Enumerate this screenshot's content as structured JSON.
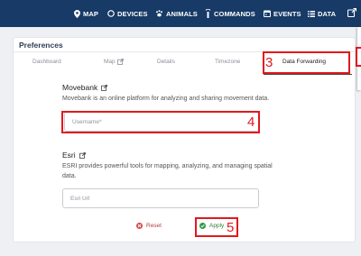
{
  "nav": {
    "items": [
      {
        "label": "MAP",
        "icon": "map-marker-icon"
      },
      {
        "label": "DEVICES",
        "icon": "devices-icon"
      },
      {
        "label": "ANIMALS",
        "icon": "paw-icon"
      },
      {
        "label": "COMMANDS",
        "icon": "antenna-icon"
      },
      {
        "label": "EVENTS",
        "icon": "calendar-icon"
      },
      {
        "label": "DATA",
        "icon": "list-icon"
      }
    ],
    "edge_icon": "export-icon",
    "bar_color": "#173a66"
  },
  "preferences": {
    "title": "Preferences",
    "tabs": [
      {
        "label": "Dashboard"
      },
      {
        "label": "Map"
      },
      {
        "label": "Details"
      },
      {
        "label": "Timezone"
      },
      {
        "label": "Data Forwarding"
      }
    ],
    "active_tab": "Data Forwarding"
  },
  "movebank": {
    "title": "Movebank",
    "description": "Movebank is an online platform for analyzing and sharing movement data.",
    "username_placeholder": "Username*",
    "username_value": ""
  },
  "esri": {
    "title": "Esri",
    "description": "ESRI provides powerful tools for mapping, analyzing, and managing spatial data.",
    "url_placeholder": "Esri Url",
    "url_value": ""
  },
  "actions": {
    "reset_label": "Reset",
    "apply_label": "Apply"
  },
  "annotations": {
    "tab_marker": "3",
    "input_marker": "4",
    "apply_marker": "5",
    "color": "#e0191e"
  }
}
